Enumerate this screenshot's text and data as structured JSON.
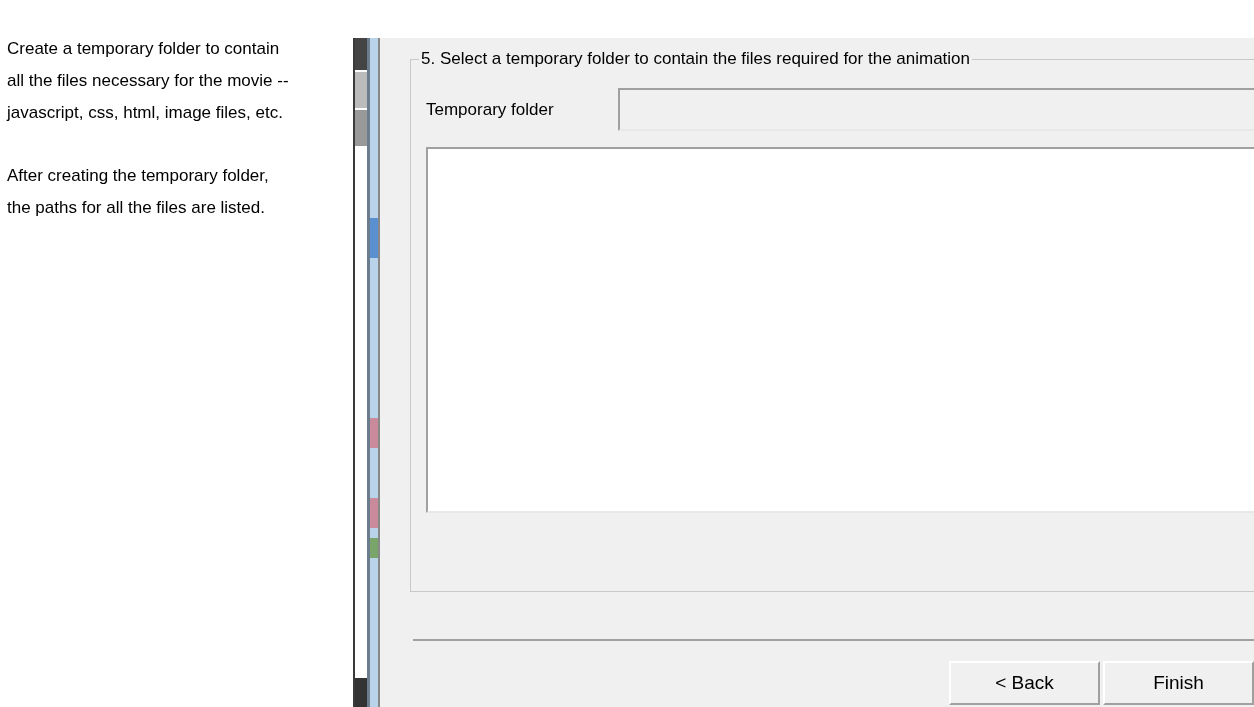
{
  "notes": [
    {
      "lines": [
        "Create a temporary folder to contain",
        "all the files necessary for the movie --",
        "javascript, css, html, image files, etc."
      ]
    },
    {
      "lines": [
        "After creating the temporary folder,",
        "the paths for all the files are listed."
      ]
    }
  ],
  "dialog": {
    "group_title": "5. Select a temporary folder to contain the files required for the animation",
    "folder_label": "Temporary folder",
    "buttons": [
      "< Back",
      "Finish"
    ]
  }
}
